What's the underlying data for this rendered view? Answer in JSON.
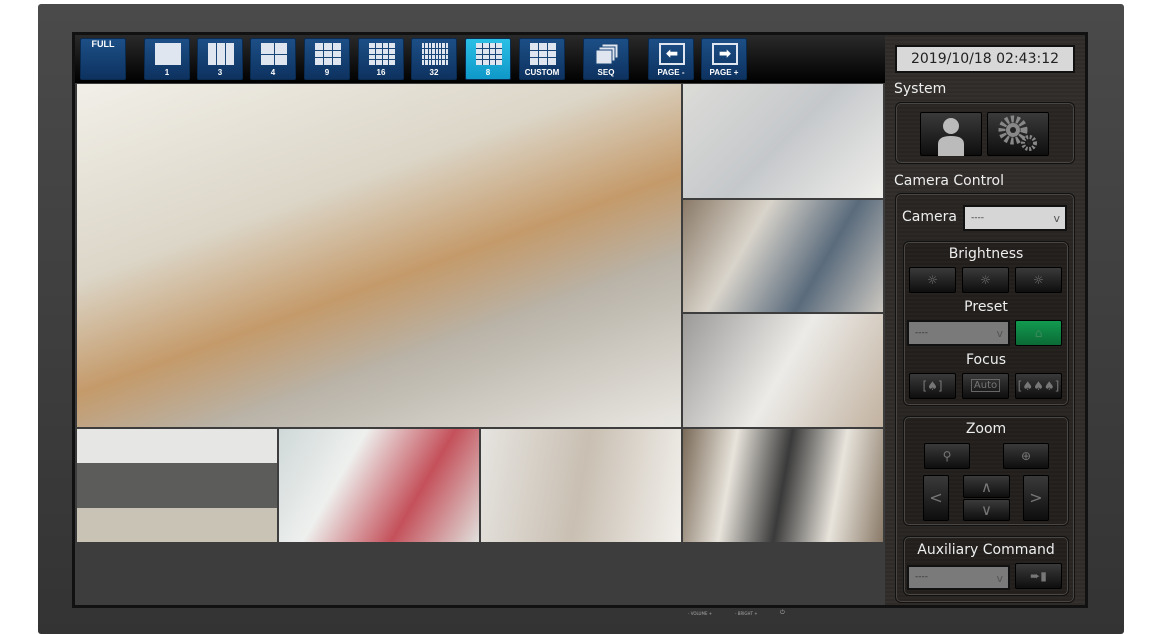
{
  "toolbar": {
    "buttons": [
      {
        "label": "FULL",
        "icon": "fullscreen-icon"
      },
      {
        "label": "1",
        "icon": "layout-1-icon"
      },
      {
        "label": "3",
        "icon": "layout-3-icon"
      },
      {
        "label": "4",
        "icon": "layout-4-icon"
      },
      {
        "label": "9",
        "icon": "layout-9-icon"
      },
      {
        "label": "16",
        "icon": "layout-16-icon"
      },
      {
        "label": "32",
        "icon": "layout-32-icon"
      },
      {
        "label": "8",
        "icon": "layout-8-icon",
        "active": true
      },
      {
        "label": "CUSTOM",
        "icon": "layout-custom-icon"
      },
      {
        "label": "SEQ",
        "icon": "sequence-icon"
      },
      {
        "label": "PAGE -",
        "icon": "arrow-left-icon"
      },
      {
        "label": "PAGE +",
        "icon": "arrow-right-icon"
      }
    ],
    "active_color": "#1fb0dc",
    "button_color": "#164577"
  },
  "panel": {
    "datetime": "2019/10/18 02:43:12",
    "system_label": "System",
    "camera_control_label": "Camera Control",
    "camera_label": "Camera",
    "camera_value": "----",
    "brightness_label": "Brightness",
    "preset_label": "Preset",
    "preset_value": "----",
    "focus_label": "Focus",
    "focus_auto": "Auto",
    "zoom_label": "Zoom",
    "aux_label": "Auxiliary Command",
    "aux_value": "----",
    "preset_home_color": "#0e7a3e"
  },
  "bezel": {
    "volume": "- VOLUME +",
    "bright": "- BRIGHT +"
  }
}
